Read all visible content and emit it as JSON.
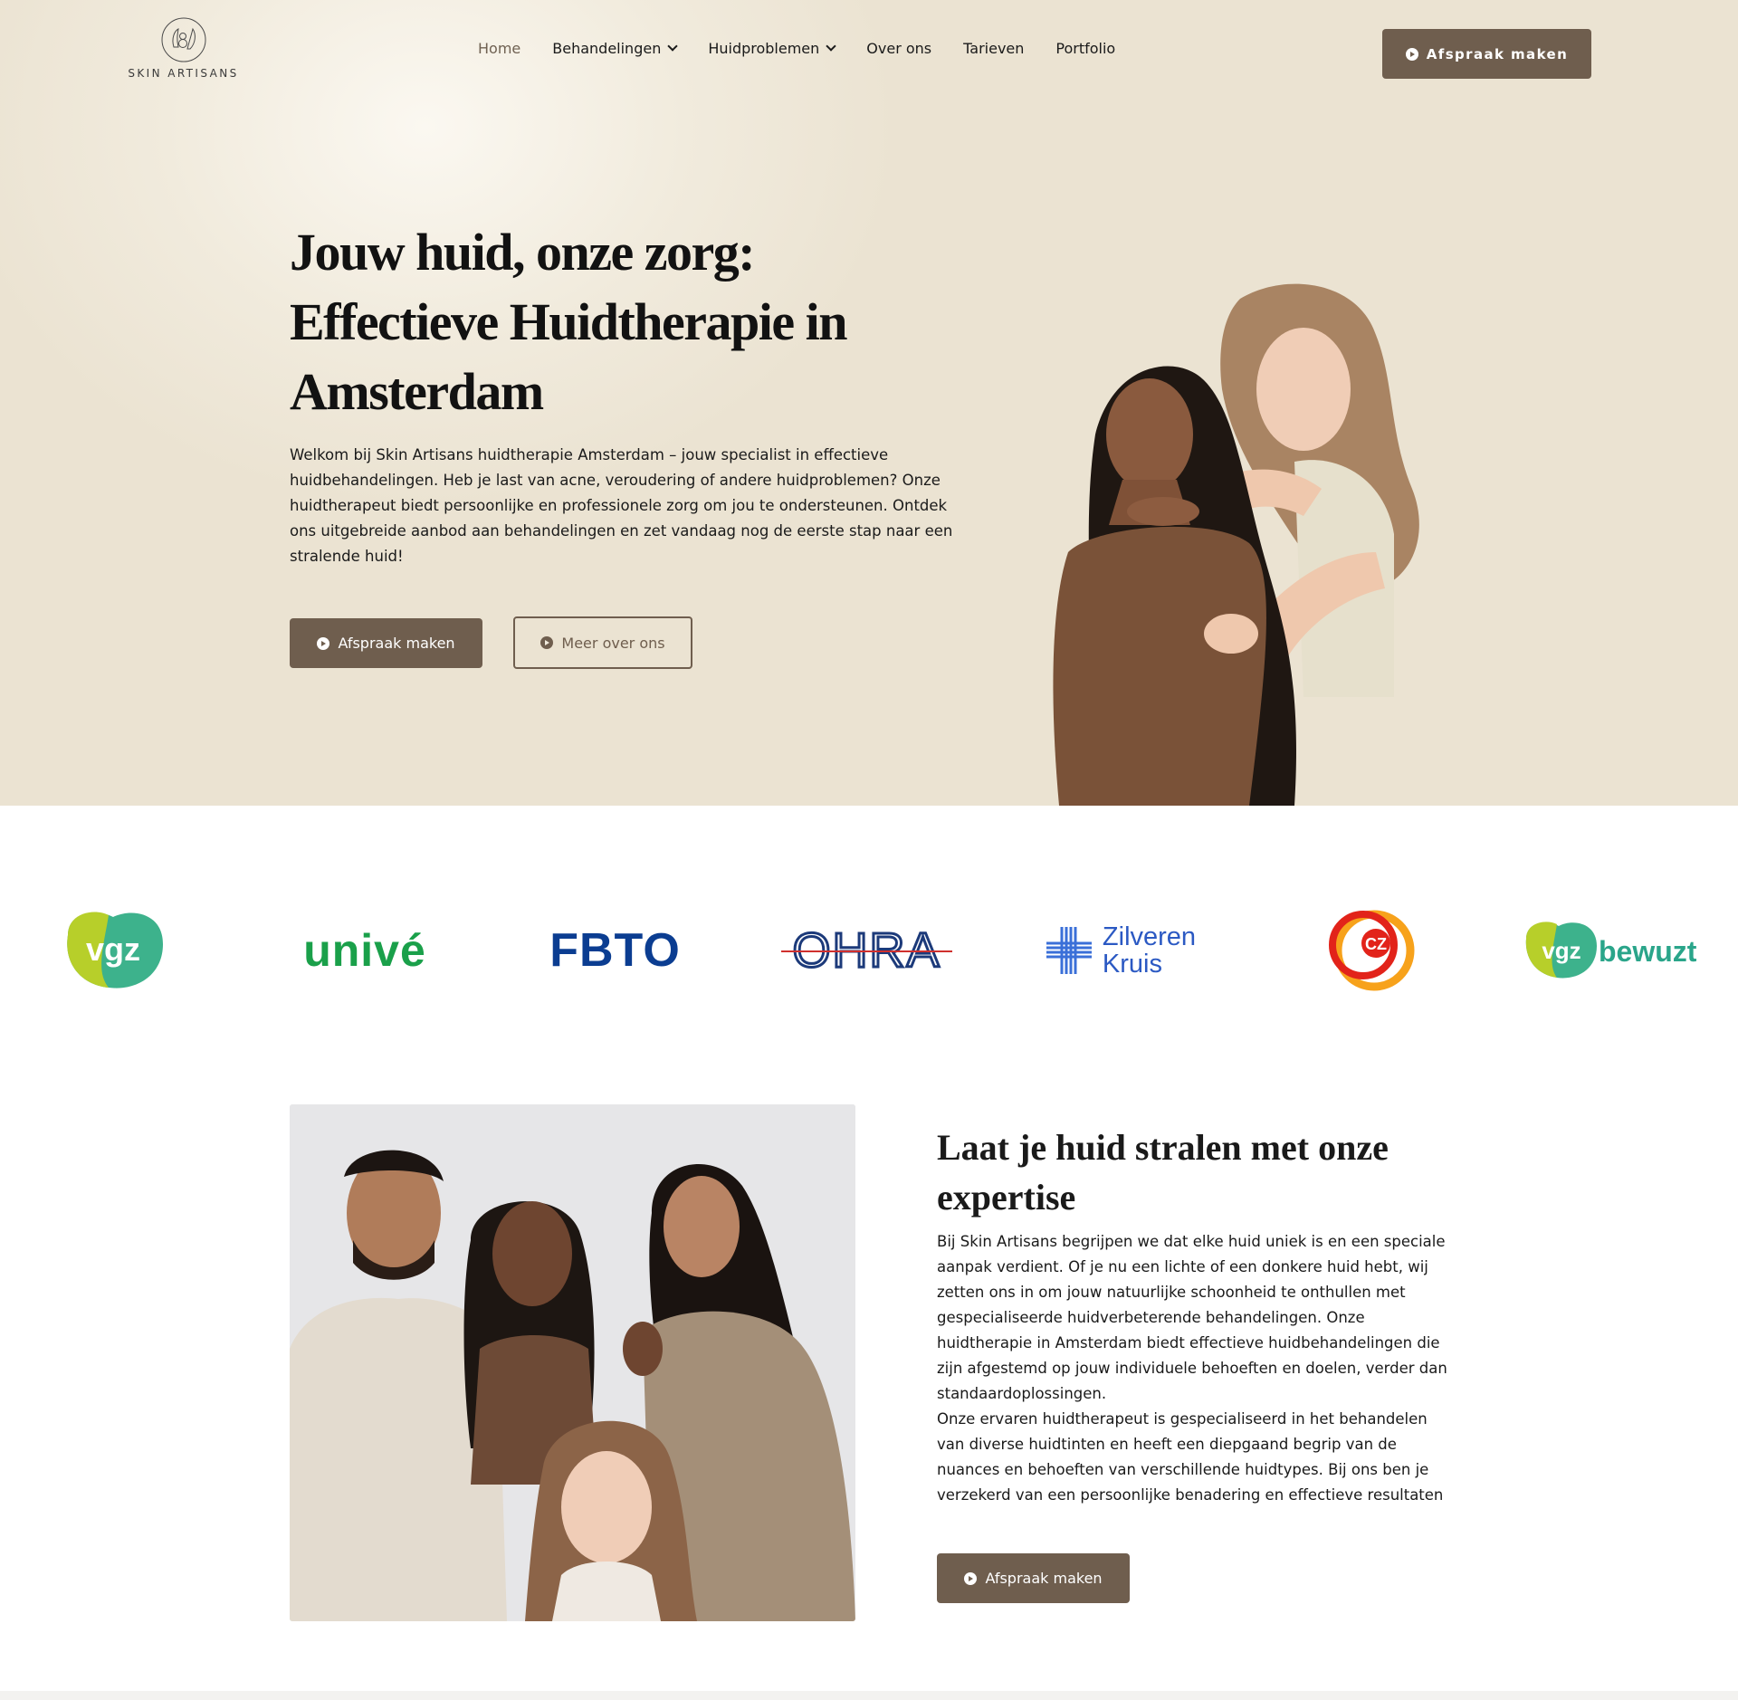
{
  "brand": {
    "name": "SKIN ARTISANS",
    "color": "#6f5e4e"
  },
  "nav": {
    "items": [
      {
        "label": "Home",
        "active": true
      },
      {
        "label": "Behandelingen",
        "dropdown": true
      },
      {
        "label": "Huidproblemen",
        "dropdown": true
      },
      {
        "label": "Over ons"
      },
      {
        "label": "Tarieven"
      },
      {
        "label": "Portfolio"
      }
    ],
    "cta": "Afspraak maken"
  },
  "hero": {
    "title_line1": "Jouw huid, onze zorg:",
    "title_line2": "Effectieve Huidtherapie in",
    "title_line3": "Amsterdam",
    "text": "Welkom bij Skin Artisans huidtherapie Amsterdam – jouw specialist in effectieve huidbehandelingen. Heb je last van acne, veroudering of andere huidproblemen? Onze huidtherapeut biedt persoonlijke en professionele zorg om jou te ondersteunen. Ontdek ons uitgebreide aanbod aan behandelingen en zet vandaag nog de eerste stap naar een stralende huid!",
    "primary_button": "Afspraak maken",
    "secondary_button": "Meer over ons"
  },
  "insurers": [
    {
      "name": "VGZ",
      "text": "vgz"
    },
    {
      "name": "Univé",
      "text": "univé"
    },
    {
      "name": "FBTO",
      "text": "FBTO"
    },
    {
      "name": "OHRA",
      "text": "OHRA"
    },
    {
      "name": "Zilveren Kruis",
      "line1": "Zilveren",
      "line2": "Kruis"
    },
    {
      "name": "CZ",
      "text": "CZ"
    },
    {
      "name": "VGZ bewuzt",
      "text": "vgz",
      "text2": "bewuzt"
    }
  ],
  "about": {
    "title": "Laat je huid stralen met onze expertise",
    "paragraph1": "Bij Skin Artisans begrijpen we dat elke huid uniek is en een speciale aanpak verdient. Of je nu een lichte of een donkere huid hebt, wij zetten ons in om jouw natuurlijke schoonheid te onthullen met gespecialiseerde huidverbeterende behandelingen. Onze huidtherapie in Amsterdam biedt effectieve huidbehandelingen die zijn afgestemd op jouw individuele behoeften en doelen, verder dan standaardoplossingen.",
    "paragraph2": "Onze ervaren huidtherapeut is gespecialiseerd in het behandelen van diverse huidtinten en heeft een diepgaand begrip van de nuances en behoeften van verschillende huidtypes. Bij ons ben je verzekerd van een persoonlijke benadering en effectieve resultaten",
    "button": "Afspraak maken"
  }
}
